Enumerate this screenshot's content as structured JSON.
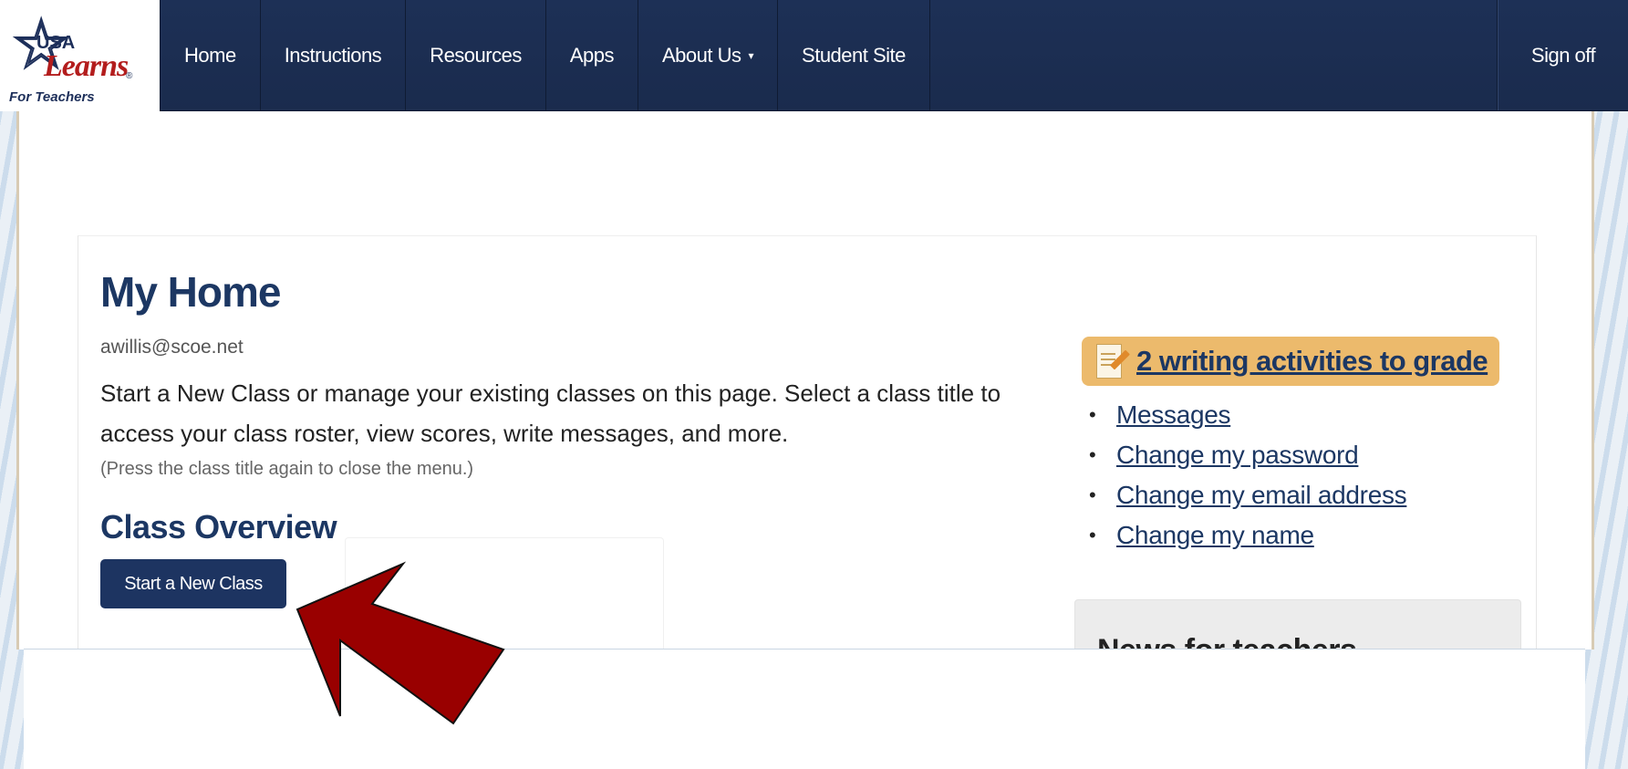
{
  "brand": {
    "usa": "USA",
    "learns": "Learns",
    "registered": "®",
    "subtitle": "For Teachers"
  },
  "nav": {
    "items": [
      {
        "label": "Home"
      },
      {
        "label": "Instructions"
      },
      {
        "label": "Resources"
      },
      {
        "label": "Apps"
      },
      {
        "label": "About Us",
        "caret": "▾"
      },
      {
        "label": "Student Site"
      }
    ],
    "signoff": "Sign off"
  },
  "main": {
    "title": "My Home",
    "email": "awillis@scoe.net",
    "description": "Start a New Class or manage your existing classes on this page. Select a class title to access your class roster, view scores, write messages, and more.",
    "hint": "(Press the class title again to close the menu.)",
    "section_title": "Class Overview",
    "start_button": "Start a New Class"
  },
  "sidebar": {
    "grade_link": "2 writing activities to grade",
    "links": [
      {
        "bullet": "•",
        "label": "Messages"
      },
      {
        "bullet": "•",
        "label": "Change my password"
      },
      {
        "bullet": "•",
        "label": "Change my email address"
      },
      {
        "bullet": "•",
        "label": "Change my name"
      }
    ],
    "news_title": "News for teachers"
  },
  "colors": {
    "navbar": "#1d3056",
    "accent_blue": "#1c3763",
    "badge": "#ecba6c",
    "arrow": "#990000"
  },
  "icons": {
    "logo_star": "star-icon",
    "grade": "writing-pencil-icon",
    "caret": "chevron-down-icon",
    "pointer": "arrow-annotation"
  }
}
